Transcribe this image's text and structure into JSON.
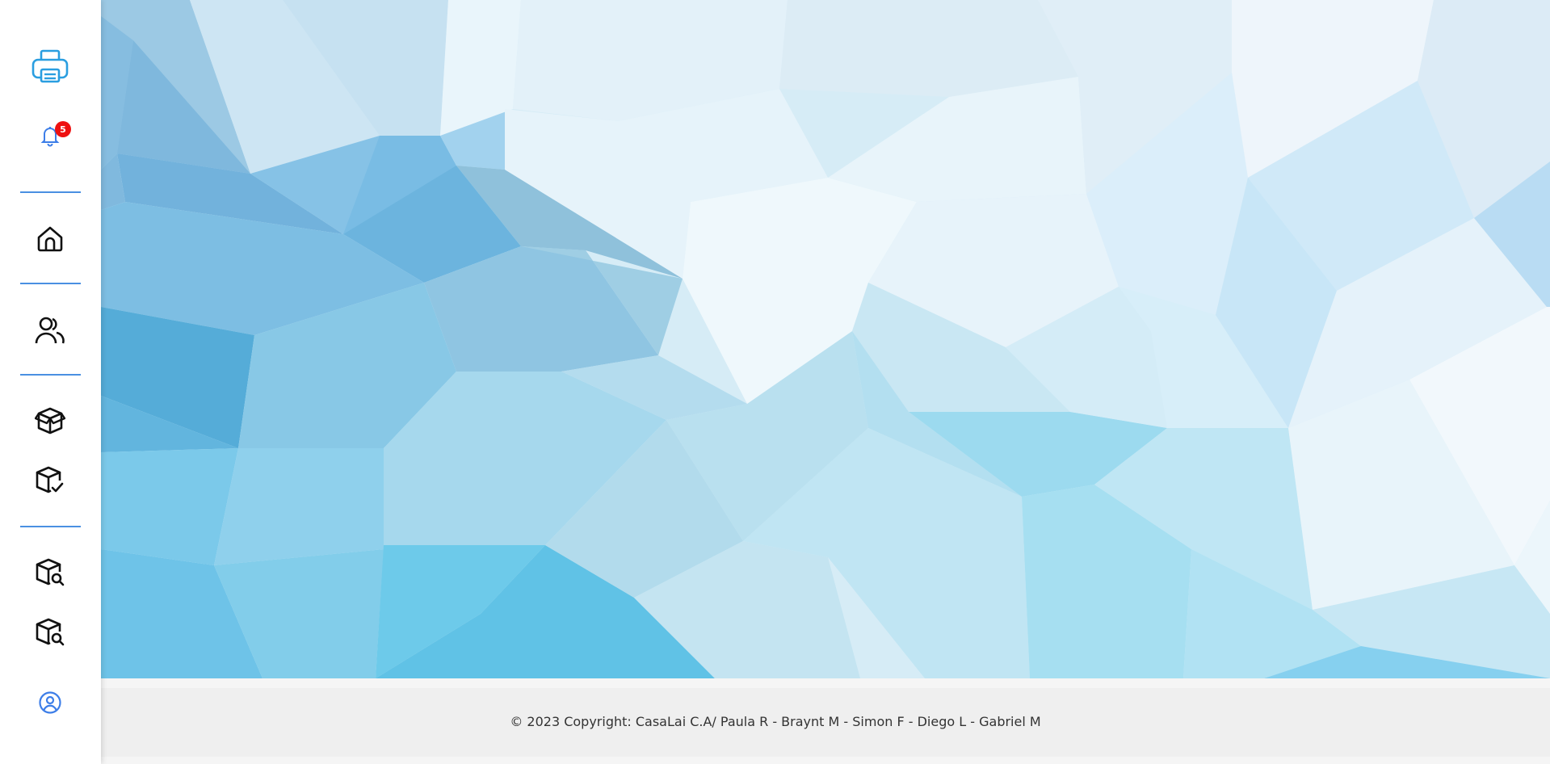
{
  "sidebar": {
    "accent_color": "#4a90e2",
    "items": [
      {
        "icon": "printer-icon",
        "color": "#2a9ee0"
      },
      {
        "icon": "bell-icon",
        "color": "#3d7ee8",
        "badge": "5"
      },
      {
        "icon": "home-icon",
        "color": "#111111"
      },
      {
        "icon": "users-icon",
        "color": "#111111"
      },
      {
        "icon": "open-box-icon",
        "color": "#111111"
      },
      {
        "icon": "box-check-icon",
        "color": "#111111"
      },
      {
        "icon": "box-search-icon",
        "color": "#111111"
      },
      {
        "icon": "box-search-icon",
        "color": "#111111"
      },
      {
        "icon": "user-circle-icon",
        "color": "#3d7ee8"
      }
    ]
  },
  "hero": {
    "background": "blue low-poly geometric pattern"
  },
  "footer": {
    "copyright": "© 2023 Copyright: CasaLai C.A/ Paula R - Braynt M - Simon F - Diego L - Gabriel M"
  }
}
